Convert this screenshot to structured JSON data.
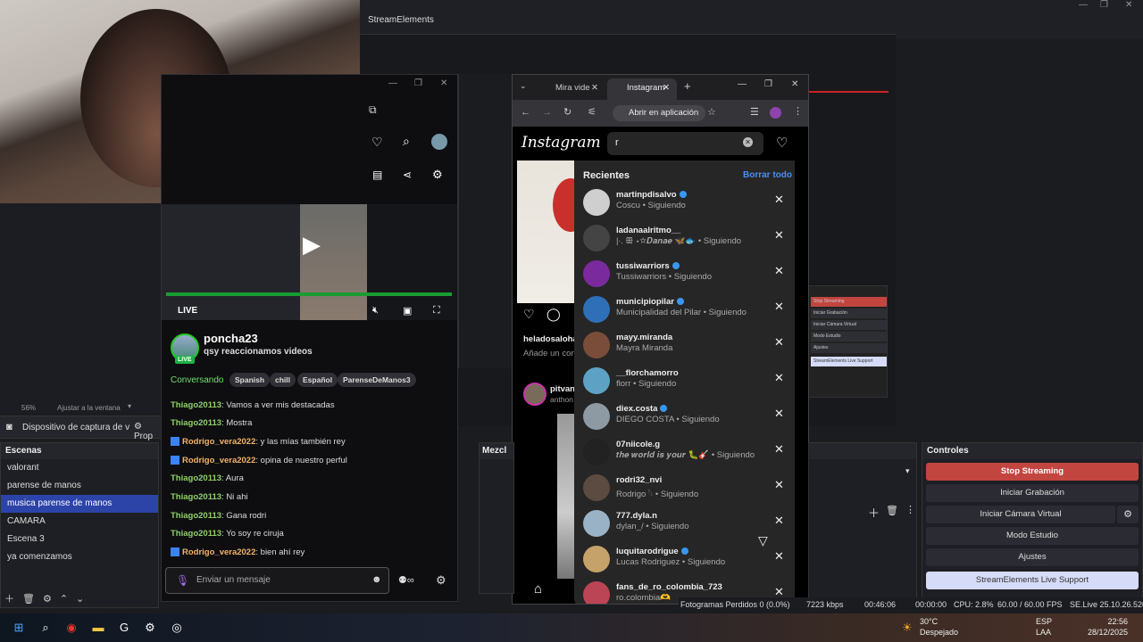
{
  "obs": {
    "window_title": "StreamElements",
    "zoom": "56%",
    "fit_label": "Ajustar a la ventana",
    "source_label": "Dispositivo de captura de v",
    "properties_label": "Prop",
    "scenes_header": "Escenas",
    "scenes": [
      "valorant",
      "parense de manos",
      "musica parense de manos",
      "CAMARA",
      "Escena 3",
      "ya comenzamos"
    ],
    "selected_scene": 2,
    "mixer_header": "Mezcl",
    "controls_header": "Controles",
    "controls": {
      "stop_streaming": "Stop Streaming",
      "start_recording": "Iniciar Grabación",
      "virtual_cam": "Iniciar Cámara Virtual",
      "studio_mode": "Modo Estudio",
      "settings": "Ajustes",
      "support": "StreamElements Live Support"
    },
    "status": {
      "frames": "Fotogramas Perdidos 0 (0.0%)",
      "bitrate": "7223 kbps",
      "rec_time": "00:00:00",
      "stream_time": "00:46:06",
      "cpu": "CPU: 2.8%",
      "fps": "60.00 / 60.00 FPS",
      "version": "SE.Live 25.10.26.520"
    },
    "mini_controls": [
      "Stop Streaming",
      "Iniciar Grabación",
      "Iniciar Cámara Virtual",
      "Modo Estudio",
      "Ajustes",
      "StreamElements Live Support"
    ]
  },
  "twitch": {
    "live_label": "LIVE",
    "channel": "poncha23",
    "stream_title": "qsy reaccionamos videos",
    "live_badge": "LIVE",
    "category": "Conversando",
    "tags": [
      "Spanish",
      "chill",
      "Español",
      "ParenseDeManos3"
    ],
    "chat": [
      {
        "user": "Thiago20113",
        "msg": "Vamos a ver mis destacadas",
        "color": "green",
        "badge": false
      },
      {
        "user": "Thiago20113",
        "msg": "Mostra",
        "color": "green",
        "badge": false
      },
      {
        "user": "Rodrigo_vera2022",
        "msg": "y las mías también rey",
        "color": "orange",
        "badge": true
      },
      {
        "user": "Rodrigo_vera2022",
        "msg": "opina de nuestro perful",
        "color": "orange",
        "badge": true
      },
      {
        "user": "Thiago20113",
        "msg": "Aura",
        "color": "green",
        "badge": false
      },
      {
        "user": "Thiago20113",
        "msg": "Ni ahi",
        "color": "green",
        "badge": false
      },
      {
        "user": "Thiago20113",
        "msg": "Gana rodri",
        "color": "green",
        "badge": false
      },
      {
        "user": "Thiago20113",
        "msg": "Yo soy re ciruja",
        "color": "green",
        "badge": false
      },
      {
        "user": "Rodrigo_vera2022",
        "msg": "bien ahí rey",
        "color": "orange",
        "badge": true
      }
    ],
    "chat_placeholder": "Enviar un mensaje"
  },
  "chrome": {
    "tab1": "Mira vide",
    "tab2": "Instagram",
    "open_app": "Abrir en aplicación"
  },
  "instagram": {
    "logo": "Instagram",
    "search_value": "r",
    "recent_header": "Recientes",
    "clear_all": "Borrar todo",
    "left_post_user": "heladosaloha",
    "left_post_comment": "Añade un con",
    "left_story_user": "pitvan",
    "left_story_sub": "anthon",
    "recent": [
      {
        "user": "martinpdisalvo",
        "sub": "Coscu • Siguiendo",
        "verified": true,
        "color": "#cfcfcf"
      },
      {
        "user": "ladanaalritmo__",
        "sub": "|∙. ꕥ ⋆☆𝑫𝒂𝒏𝒂𝒆 🦋🐟 • Siguiendo",
        "verified": false,
        "color": "#444"
      },
      {
        "user": "tussiwarriors",
        "sub": "Tussiwarriors • Siguiendo",
        "verified": true,
        "color": "#7b2a9e"
      },
      {
        "user": "municipiopilar",
        "sub": "Municipalidad del Pilar • Siguiendo",
        "verified": true,
        "color": "#2f6fb8"
      },
      {
        "user": "mayy.miranda",
        "sub": "Mayra Miranda",
        "verified": false,
        "color": "#7a4d3b"
      },
      {
        "user": "__florchamorro",
        "sub": "florr • Siguiendo",
        "verified": false,
        "color": "#5da2c4"
      },
      {
        "user": "diex.costa",
        "sub": "DIEGO COSTA • Siguiendo",
        "verified": true,
        "color": "#8e9aa3"
      },
      {
        "user": "07niicole.g",
        "sub": "𝒕𝒉𝒆 𝒘𝒐𝒓𝒍𝒅 𝒊𝒔 𝒚𝒐𝒖𝒓 🐛🎸 • Siguiendo",
        "verified": false,
        "color": "#222"
      },
      {
        "user": "rodri32_nvi",
        "sub": "Rodrigo 𓆩 • Siguiendo",
        "verified": false,
        "color": "#5b4b40"
      },
      {
        "user": "777.dyla.n",
        "sub": "dylan_/ • Siguiendo",
        "verified": false,
        "color": "#9ab2c6"
      },
      {
        "user": "luquitarodrigue",
        "sub": "Lucas Rodriguez • Siguiendo",
        "verified": true,
        "color": "#c4a26a"
      },
      {
        "user": "fans_de_ro_colombia_723",
        "sub": "ro.colombia🫶",
        "verified": false,
        "color": "#b45"
      }
    ]
  },
  "taskbar": {
    "temp": "30°C",
    "weather": "Despejado",
    "lang": "ESP",
    "lang2": "LAA",
    "time": "22:56",
    "date": "28/12/2025"
  }
}
